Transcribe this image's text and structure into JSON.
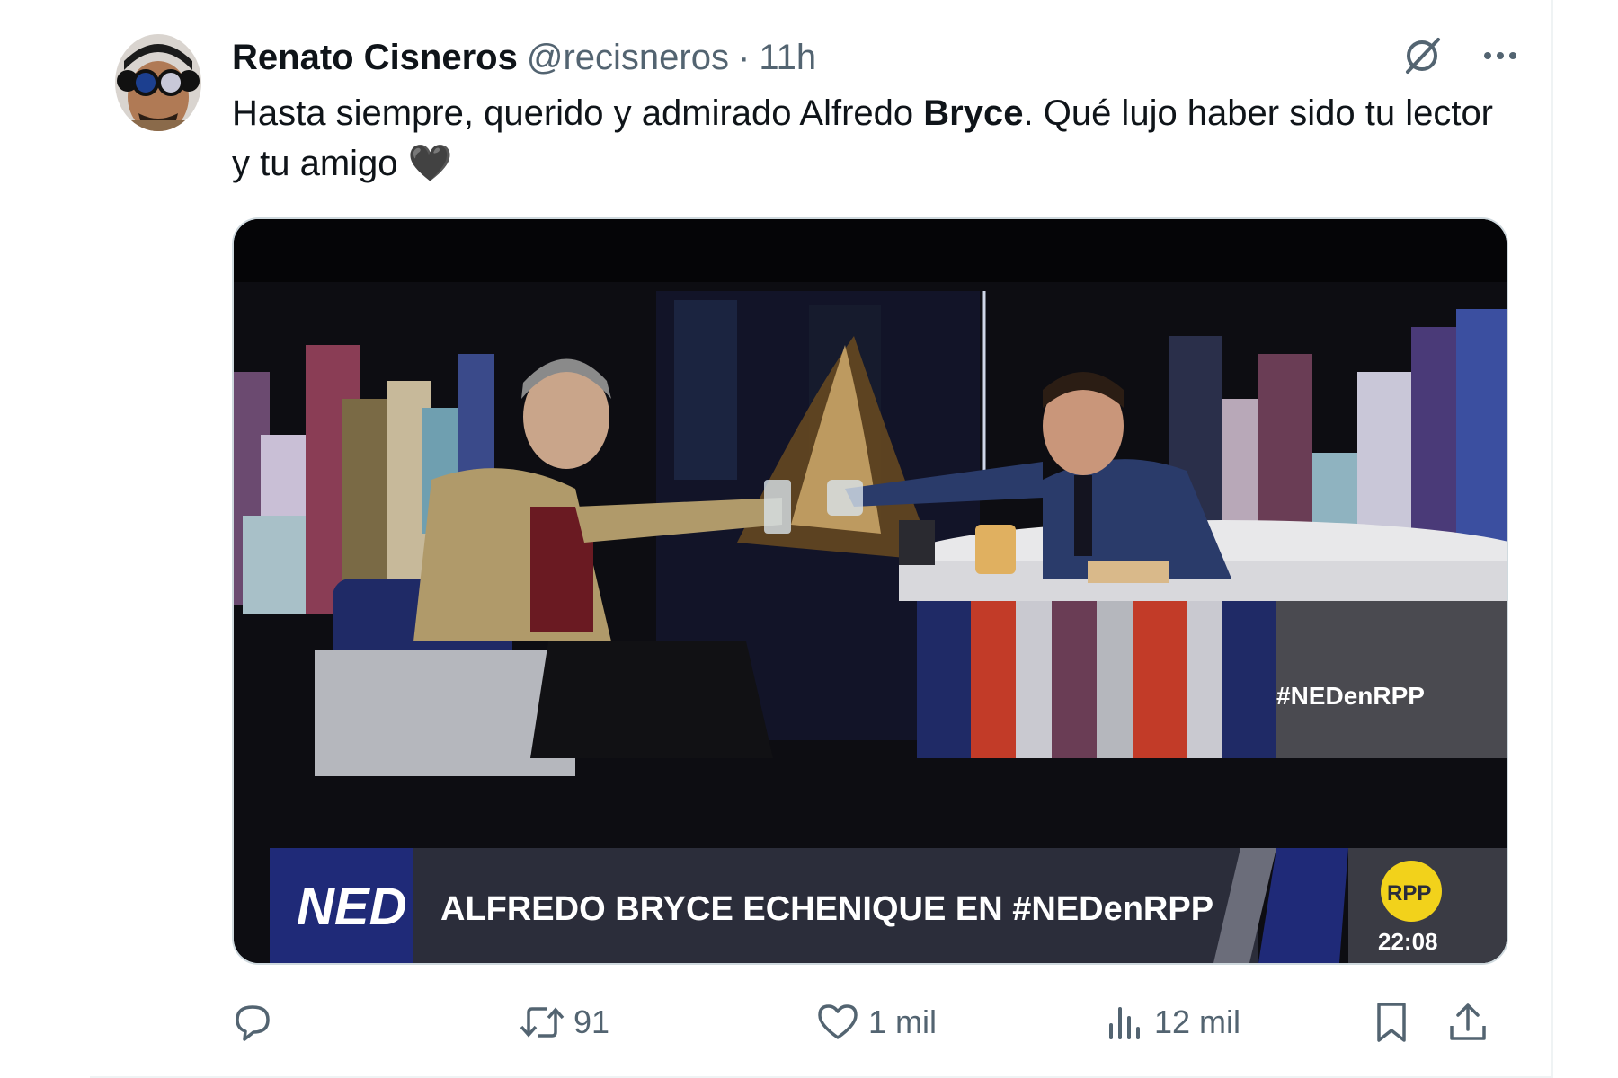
{
  "tweet": {
    "author_name": "Renato Cisneros",
    "handle": "@recisneros",
    "separator": "·",
    "time": "11h",
    "text_part1": "Hasta siempre, querido y admirado Alfredo ",
    "text_bold": "Bryce",
    "text_part2": ". Qué lujo haber sido tu lector y tu amigo ",
    "emoji": "🖤"
  },
  "media": {
    "hashtag_overlay": "#NEDenRPP",
    "lower_third_logo": "NED",
    "lower_third_title": "ALFREDO BRYCE ECHENIQUE EN #NEDenRPP",
    "channel_logo": "RPP",
    "clock": "22:08"
  },
  "actions": {
    "reply_count": "",
    "retweet_count": "91",
    "like_count": "1 mil",
    "views_count": "12 mil"
  },
  "icons": {
    "grok": "slashed-circle-icon",
    "more": "more-dots-icon",
    "reply": "reply-icon",
    "retweet": "retweet-icon",
    "like": "heart-icon",
    "views": "views-icon",
    "bookmark": "bookmark-icon",
    "share": "share-icon"
  },
  "colors": {
    "text_primary": "#0f1419",
    "text_secondary": "#536471",
    "border": "#cfd9de",
    "ned_blue": "#1f2a78",
    "rpp_yellow": "#f2d21b"
  }
}
